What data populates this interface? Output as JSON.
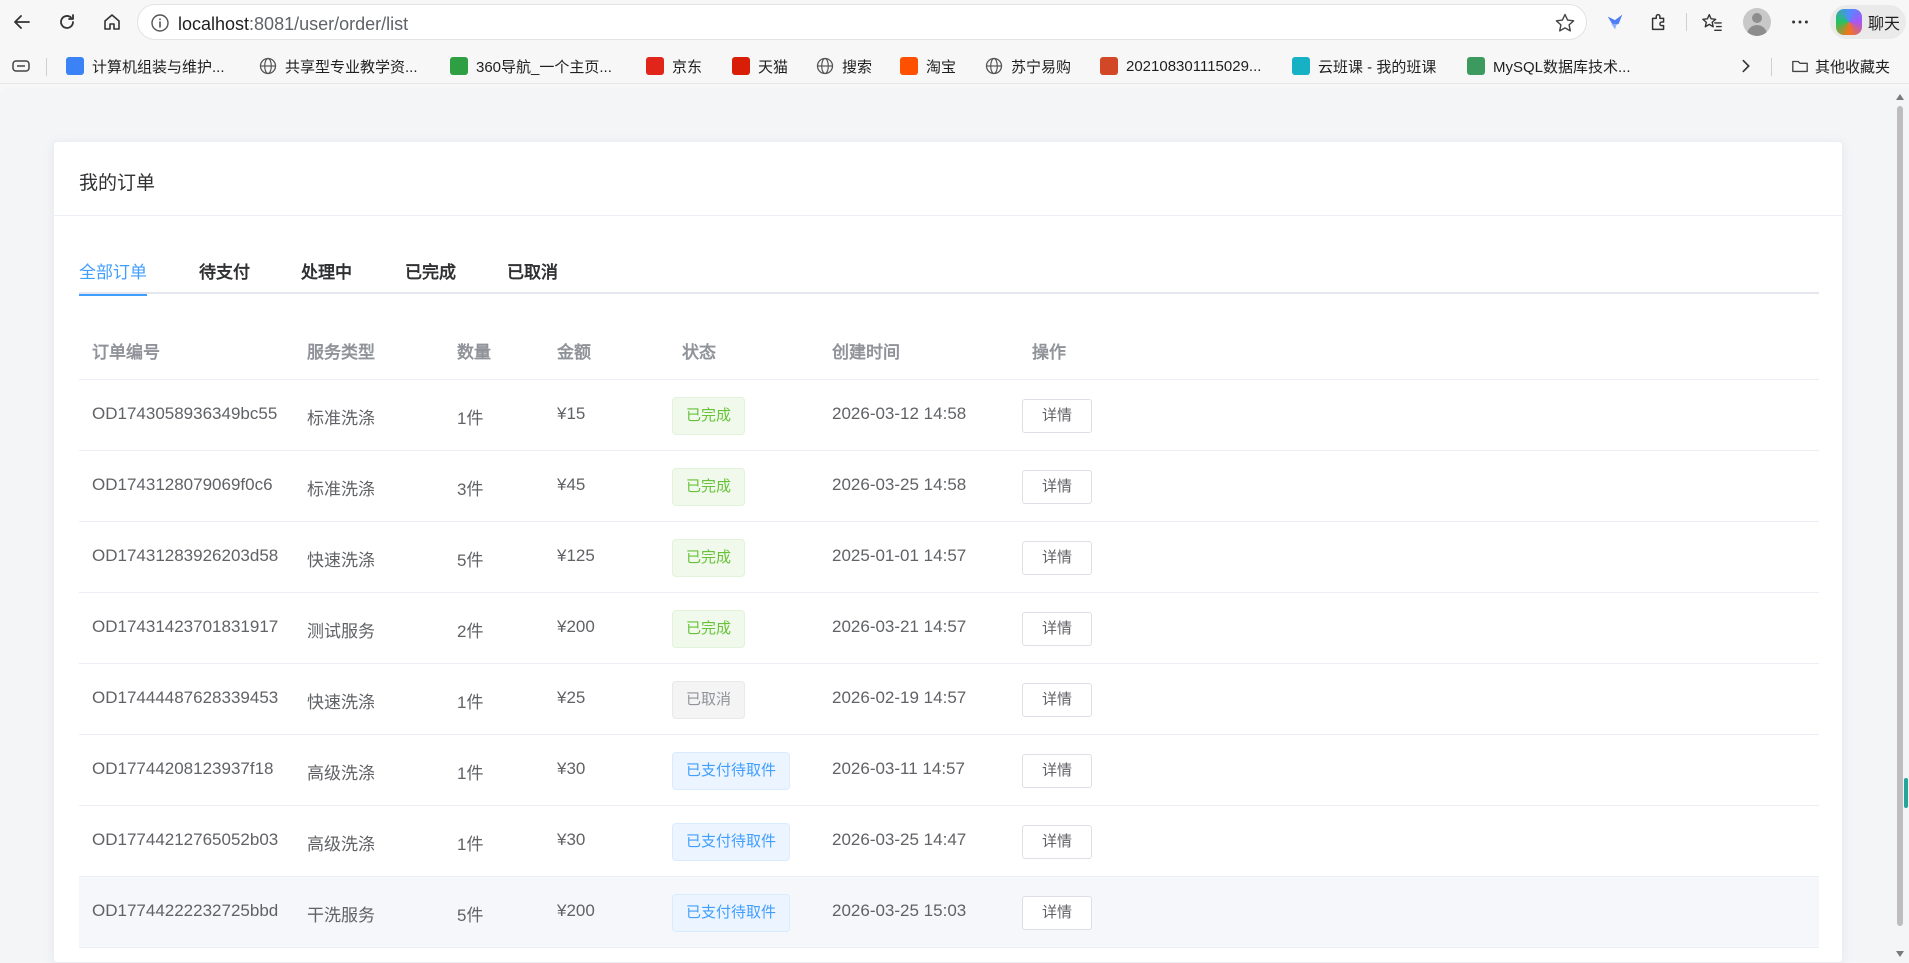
{
  "browser": {
    "url_host": "localhost",
    "url_path": ":8081/user/order/list",
    "chat_label": "聊天",
    "bookmarks": [
      {
        "label": "计算机组装与维护...",
        "icon": "app-grid-icon",
        "color": "#3b82f6"
      },
      {
        "label": "共享型专业教学资...",
        "icon": "globe-icon",
        "color": "#5f6368"
      },
      {
        "label": "360导航_一个主页...",
        "icon": "360-icon",
        "color": "#2ea043"
      },
      {
        "label": "京东",
        "icon": "jd-icon",
        "color": "#e1251b"
      },
      {
        "label": "天猫",
        "icon": "tmall-icon",
        "color": "#d81e06"
      },
      {
        "label": "搜索",
        "icon": "globe-icon",
        "color": "#5f6368"
      },
      {
        "label": "淘宝",
        "icon": "taobao-icon",
        "color": "#ff5000"
      },
      {
        "label": "苏宁易购",
        "icon": "globe-icon",
        "color": "#5f6368"
      },
      {
        "label": "202108301115029...",
        "icon": "ppt-icon",
        "color": "#d24726"
      },
      {
        "label": "云班课 - 我的班课",
        "icon": "cloud-class-icon",
        "color": "#16b1c4"
      },
      {
        "label": "MySQL数据库技术...",
        "icon": "book-icon",
        "color": "#3c9a5f"
      }
    ],
    "other_bookmarks": "其他收藏夹"
  },
  "page": {
    "title": "我的订单",
    "tabs": [
      {
        "label": "全部订单",
        "active": true
      },
      {
        "label": "待支付",
        "active": false
      },
      {
        "label": "处理中",
        "active": false
      },
      {
        "label": "已完成",
        "active": false
      },
      {
        "label": "已取消",
        "active": false
      }
    ],
    "columns": [
      "订单编号",
      "服务类型",
      "数量",
      "金额",
      "状态",
      "创建时间",
      "操作"
    ],
    "orders": [
      {
        "id": "OD1743058936349bc55",
        "service": "标准洗涤",
        "qty": "1件",
        "amount": "¥15",
        "status": "已完成",
        "status_type": "success",
        "created": "2026-03-12 14:58",
        "action": "详情"
      },
      {
        "id": "OD1743128079069f0c6",
        "service": "标准洗涤",
        "qty": "3件",
        "amount": "¥45",
        "status": "已完成",
        "status_type": "success",
        "created": "2026-03-25 14:58",
        "action": "详情"
      },
      {
        "id": "OD17431283926203d58",
        "service": "快速洗涤",
        "qty": "5件",
        "amount": "¥125",
        "status": "已完成",
        "status_type": "success",
        "created": "2025-01-01 14:57",
        "action": "详情"
      },
      {
        "id": "OD17431423701831917",
        "service": "测试服务",
        "qty": "2件",
        "amount": "¥200",
        "status": "已完成",
        "status_type": "success",
        "created": "2026-03-21 14:57",
        "action": "详情"
      },
      {
        "id": "OD17444487628339453",
        "service": "快速洗涤",
        "qty": "1件",
        "amount": "¥25",
        "status": "已取消",
        "status_type": "info",
        "created": "2026-02-19 14:57",
        "action": "详情"
      },
      {
        "id": "OD17744208123937f18",
        "service": "高级洗涤",
        "qty": "1件",
        "amount": "¥30",
        "status": "已支付待取件",
        "status_type": "primary",
        "created": "2026-03-11 14:57",
        "action": "详情"
      },
      {
        "id": "OD17744212765052b03",
        "service": "高级洗涤",
        "qty": "1件",
        "amount": "¥30",
        "status": "已支付待取件",
        "status_type": "primary",
        "created": "2026-03-25 14:47",
        "action": "详情"
      },
      {
        "id": "OD17744222232725bbd",
        "service": "干洗服务",
        "qty": "5件",
        "amount": "¥200",
        "status": "已支付待取件",
        "status_type": "primary",
        "created": "2026-03-25 15:03",
        "action": "详情"
      }
    ]
  },
  "colors": {
    "accent": "#409eff",
    "success_text": "#67c23a",
    "success_bg": "#f0f9eb",
    "success_border": "#e1f3d8",
    "info_text": "#909399",
    "info_bg": "#f4f4f5",
    "info_border": "#e9e9eb",
    "primary_text": "#409eff",
    "primary_bg": "#ecf5ff",
    "primary_border": "#d9ecff"
  }
}
